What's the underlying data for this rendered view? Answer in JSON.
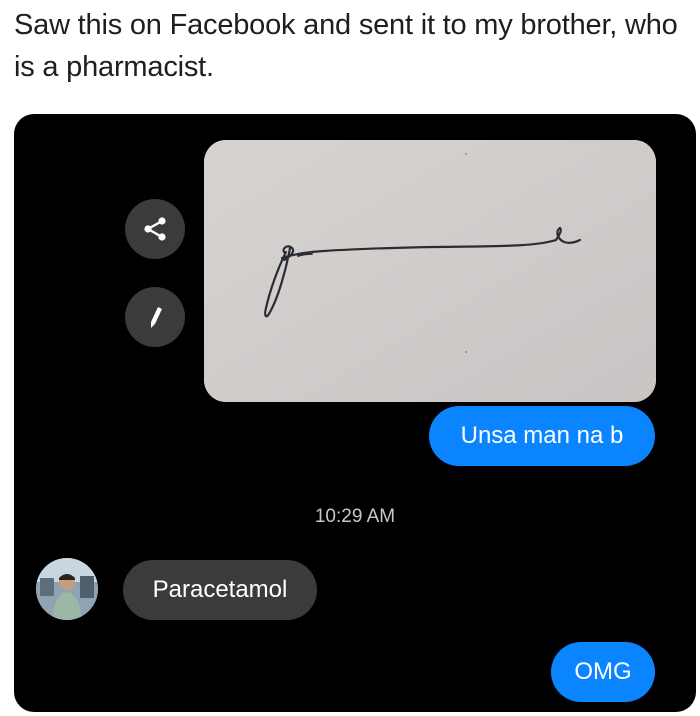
{
  "post": {
    "caption": "Saw this on Facebook and sent it to my brother, who is a pharmacist."
  },
  "chat": {
    "photo": {
      "description_icon": "scribble-signature"
    },
    "actions": [
      {
        "name": "share",
        "icon": "share-icon"
      },
      {
        "name": "info",
        "icon": "pencil-icon"
      }
    ],
    "messages": [
      {
        "side": "sent",
        "text": "Unsa man na b"
      },
      {
        "side": "received",
        "text": "Paracetamol"
      },
      {
        "side": "sent",
        "text": "OMG"
      }
    ],
    "timestamp": "10:29 AM"
  },
  "colors": {
    "background": "#000000",
    "sent_bubble": "#0a84ff",
    "received_bubble": "#3a3b3c",
    "photo_paper": "#d1cdcc"
  }
}
